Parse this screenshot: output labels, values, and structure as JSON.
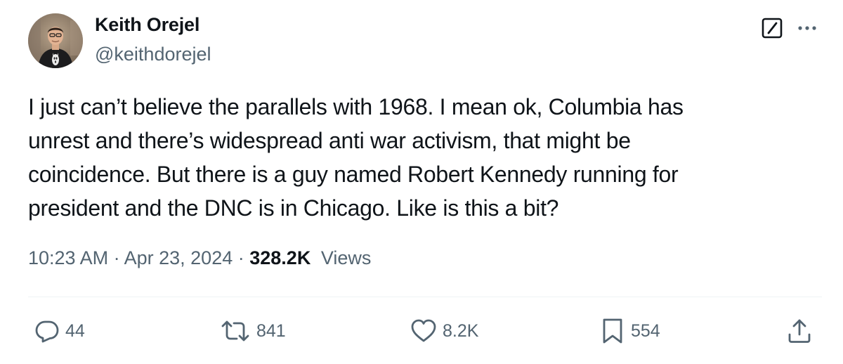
{
  "author": {
    "display_name": "Keith Orejel",
    "handle": "@keithdorejel",
    "avatar_icon": "profile-photo"
  },
  "header_actions": {
    "grok_icon": "grok-icon",
    "more_icon": "more-horizontal-icon"
  },
  "tweet": {
    "text": "I just can’t believe the parallels with 1968. I mean ok, Columbia has\nunrest and there’s widespread anti war activism, that might be\ncoincidence. But there is a guy named Robert Kennedy running for\npresident and the DNC is in Chicago. Like is this a bit?",
    "time": "10:23 AM",
    "separator": "·",
    "date": "Apr 23, 2024",
    "views_count": "328.2K",
    "views_label": "Views"
  },
  "actions": {
    "replies": "44",
    "reposts": "841",
    "likes": "8.2K",
    "bookmarks": "554",
    "icons": [
      "reply-icon",
      "repost-icon",
      "like-icon",
      "bookmark-icon",
      "share-icon"
    ]
  },
  "colors": {
    "text_primary": "#0f1419",
    "text_secondary": "#536471",
    "divider": "#eff3f4"
  }
}
